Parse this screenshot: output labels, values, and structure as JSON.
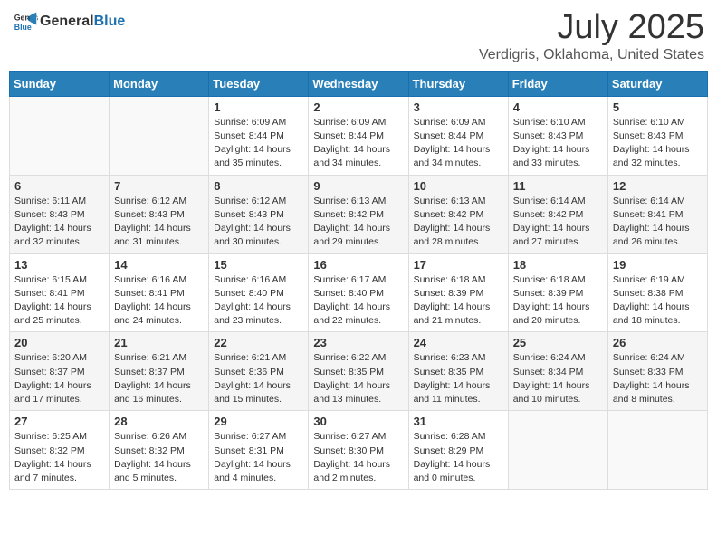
{
  "header": {
    "logo_general": "General",
    "logo_blue": "Blue",
    "month": "July 2025",
    "location": "Verdigris, Oklahoma, United States"
  },
  "days_of_week": [
    "Sunday",
    "Monday",
    "Tuesday",
    "Wednesday",
    "Thursday",
    "Friday",
    "Saturday"
  ],
  "weeks": [
    [
      {
        "day": "",
        "sunrise": "",
        "sunset": "",
        "daylight": ""
      },
      {
        "day": "",
        "sunrise": "",
        "sunset": "",
        "daylight": ""
      },
      {
        "day": "1",
        "sunrise": "Sunrise: 6:09 AM",
        "sunset": "Sunset: 8:44 PM",
        "daylight": "Daylight: 14 hours and 35 minutes."
      },
      {
        "day": "2",
        "sunrise": "Sunrise: 6:09 AM",
        "sunset": "Sunset: 8:44 PM",
        "daylight": "Daylight: 14 hours and 34 minutes."
      },
      {
        "day": "3",
        "sunrise": "Sunrise: 6:09 AM",
        "sunset": "Sunset: 8:44 PM",
        "daylight": "Daylight: 14 hours and 34 minutes."
      },
      {
        "day": "4",
        "sunrise": "Sunrise: 6:10 AM",
        "sunset": "Sunset: 8:43 PM",
        "daylight": "Daylight: 14 hours and 33 minutes."
      },
      {
        "day": "5",
        "sunrise": "Sunrise: 6:10 AM",
        "sunset": "Sunset: 8:43 PM",
        "daylight": "Daylight: 14 hours and 32 minutes."
      }
    ],
    [
      {
        "day": "6",
        "sunrise": "Sunrise: 6:11 AM",
        "sunset": "Sunset: 8:43 PM",
        "daylight": "Daylight: 14 hours and 32 minutes."
      },
      {
        "day": "7",
        "sunrise": "Sunrise: 6:12 AM",
        "sunset": "Sunset: 8:43 PM",
        "daylight": "Daylight: 14 hours and 31 minutes."
      },
      {
        "day": "8",
        "sunrise": "Sunrise: 6:12 AM",
        "sunset": "Sunset: 8:43 PM",
        "daylight": "Daylight: 14 hours and 30 minutes."
      },
      {
        "day": "9",
        "sunrise": "Sunrise: 6:13 AM",
        "sunset": "Sunset: 8:42 PM",
        "daylight": "Daylight: 14 hours and 29 minutes."
      },
      {
        "day": "10",
        "sunrise": "Sunrise: 6:13 AM",
        "sunset": "Sunset: 8:42 PM",
        "daylight": "Daylight: 14 hours and 28 minutes."
      },
      {
        "day": "11",
        "sunrise": "Sunrise: 6:14 AM",
        "sunset": "Sunset: 8:42 PM",
        "daylight": "Daylight: 14 hours and 27 minutes."
      },
      {
        "day": "12",
        "sunrise": "Sunrise: 6:14 AM",
        "sunset": "Sunset: 8:41 PM",
        "daylight": "Daylight: 14 hours and 26 minutes."
      }
    ],
    [
      {
        "day": "13",
        "sunrise": "Sunrise: 6:15 AM",
        "sunset": "Sunset: 8:41 PM",
        "daylight": "Daylight: 14 hours and 25 minutes."
      },
      {
        "day": "14",
        "sunrise": "Sunrise: 6:16 AM",
        "sunset": "Sunset: 8:41 PM",
        "daylight": "Daylight: 14 hours and 24 minutes."
      },
      {
        "day": "15",
        "sunrise": "Sunrise: 6:16 AM",
        "sunset": "Sunset: 8:40 PM",
        "daylight": "Daylight: 14 hours and 23 minutes."
      },
      {
        "day": "16",
        "sunrise": "Sunrise: 6:17 AM",
        "sunset": "Sunset: 8:40 PM",
        "daylight": "Daylight: 14 hours and 22 minutes."
      },
      {
        "day": "17",
        "sunrise": "Sunrise: 6:18 AM",
        "sunset": "Sunset: 8:39 PM",
        "daylight": "Daylight: 14 hours and 21 minutes."
      },
      {
        "day": "18",
        "sunrise": "Sunrise: 6:18 AM",
        "sunset": "Sunset: 8:39 PM",
        "daylight": "Daylight: 14 hours and 20 minutes."
      },
      {
        "day": "19",
        "sunrise": "Sunrise: 6:19 AM",
        "sunset": "Sunset: 8:38 PM",
        "daylight": "Daylight: 14 hours and 18 minutes."
      }
    ],
    [
      {
        "day": "20",
        "sunrise": "Sunrise: 6:20 AM",
        "sunset": "Sunset: 8:37 PM",
        "daylight": "Daylight: 14 hours and 17 minutes."
      },
      {
        "day": "21",
        "sunrise": "Sunrise: 6:21 AM",
        "sunset": "Sunset: 8:37 PM",
        "daylight": "Daylight: 14 hours and 16 minutes."
      },
      {
        "day": "22",
        "sunrise": "Sunrise: 6:21 AM",
        "sunset": "Sunset: 8:36 PM",
        "daylight": "Daylight: 14 hours and 15 minutes."
      },
      {
        "day": "23",
        "sunrise": "Sunrise: 6:22 AM",
        "sunset": "Sunset: 8:35 PM",
        "daylight": "Daylight: 14 hours and 13 minutes."
      },
      {
        "day": "24",
        "sunrise": "Sunrise: 6:23 AM",
        "sunset": "Sunset: 8:35 PM",
        "daylight": "Daylight: 14 hours and 11 minutes."
      },
      {
        "day": "25",
        "sunrise": "Sunrise: 6:24 AM",
        "sunset": "Sunset: 8:34 PM",
        "daylight": "Daylight: 14 hours and 10 minutes."
      },
      {
        "day": "26",
        "sunrise": "Sunrise: 6:24 AM",
        "sunset": "Sunset: 8:33 PM",
        "daylight": "Daylight: 14 hours and 8 minutes."
      }
    ],
    [
      {
        "day": "27",
        "sunrise": "Sunrise: 6:25 AM",
        "sunset": "Sunset: 8:32 PM",
        "daylight": "Daylight: 14 hours and 7 minutes."
      },
      {
        "day": "28",
        "sunrise": "Sunrise: 6:26 AM",
        "sunset": "Sunset: 8:32 PM",
        "daylight": "Daylight: 14 hours and 5 minutes."
      },
      {
        "day": "29",
        "sunrise": "Sunrise: 6:27 AM",
        "sunset": "Sunset: 8:31 PM",
        "daylight": "Daylight: 14 hours and 4 minutes."
      },
      {
        "day": "30",
        "sunrise": "Sunrise: 6:27 AM",
        "sunset": "Sunset: 8:30 PM",
        "daylight": "Daylight: 14 hours and 2 minutes."
      },
      {
        "day": "31",
        "sunrise": "Sunrise: 6:28 AM",
        "sunset": "Sunset: 8:29 PM",
        "daylight": "Daylight: 14 hours and 0 minutes."
      },
      {
        "day": "",
        "sunrise": "",
        "sunset": "",
        "daylight": ""
      },
      {
        "day": "",
        "sunrise": "",
        "sunset": "",
        "daylight": ""
      }
    ]
  ]
}
